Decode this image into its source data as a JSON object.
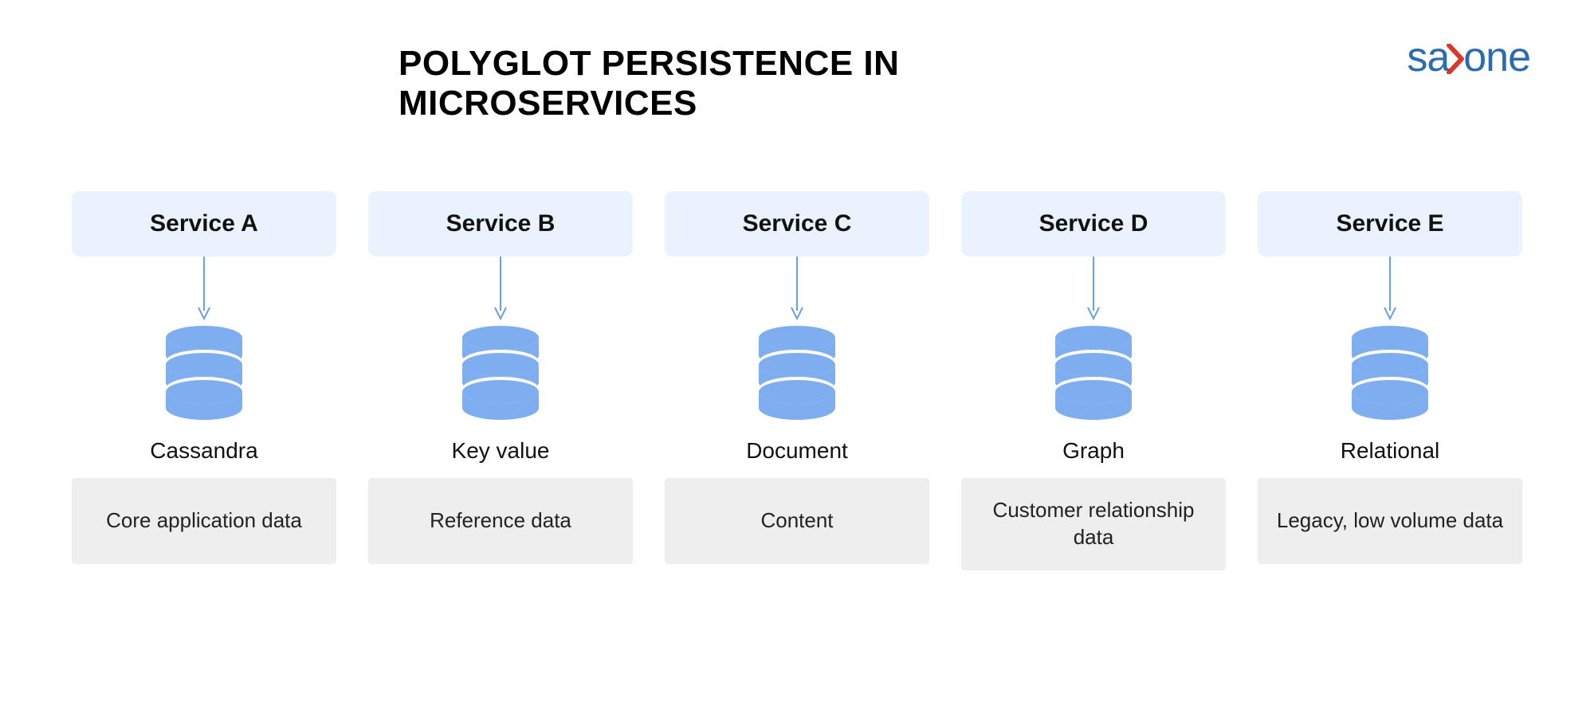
{
  "title": "POLYGLOT PERSISTENCE IN MICROSERVICES",
  "logo": {
    "part1": "sa",
    "part2": "one"
  },
  "colors": {
    "accent": "#7eaef0",
    "arrow": "#6aa0e8",
    "serviceBoxBg": "#eaf2fd",
    "dataBoxBg": "#eeeeee",
    "logoBlue": "#2b6cb0",
    "logoRed": "#d9372c"
  },
  "services": [
    {
      "name": "Service A",
      "dbType": "Cassandra",
      "dataDesc": "Core application data"
    },
    {
      "name": "Service B",
      "dbType": "Key value",
      "dataDesc": "Reference data"
    },
    {
      "name": "Service C",
      "dbType": "Document",
      "dataDesc": "Content"
    },
    {
      "name": "Service D",
      "dbType": "Graph",
      "dataDesc": "Customer relationship data"
    },
    {
      "name": "Service E",
      "dbType": "Relational",
      "dataDesc": "Legacy, low volume data"
    }
  ]
}
